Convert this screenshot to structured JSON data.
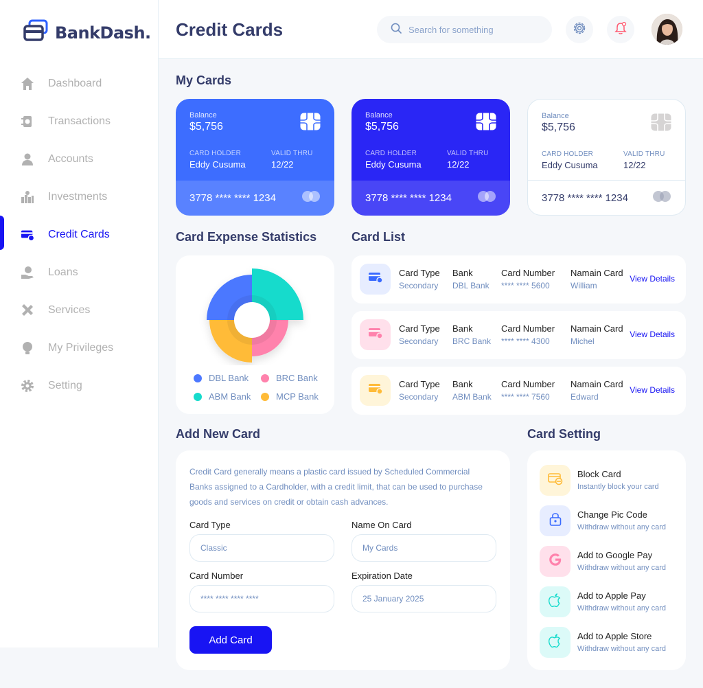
{
  "app": {
    "name": "BankDash."
  },
  "header": {
    "title": "Credit Cards",
    "search_placeholder": "Search for something"
  },
  "sidebar": {
    "items": [
      {
        "label": "Dashboard",
        "icon": "home-icon",
        "active": false
      },
      {
        "label": "Transactions",
        "icon": "transfer-icon",
        "active": false
      },
      {
        "label": "Accounts",
        "icon": "user-icon",
        "active": false
      },
      {
        "label": "Investments",
        "icon": "investment-icon",
        "active": false
      },
      {
        "label": "Credit Cards",
        "icon": "credit-card-icon",
        "active": true
      },
      {
        "label": "Loans",
        "icon": "loan-icon",
        "active": false
      },
      {
        "label": "Services",
        "icon": "services-icon",
        "active": false
      },
      {
        "label": "My Privileges",
        "icon": "lightbulb-icon",
        "active": false
      },
      {
        "label": "Setting",
        "icon": "gear-icon",
        "active": false
      }
    ]
  },
  "sections": {
    "my_cards": "My Cards",
    "expense_stats": "Card Expense Statistics",
    "card_list": "Card List",
    "add_new_card": "Add New Card",
    "card_setting": "Card Setting"
  },
  "cards": [
    {
      "balance_label": "Balance",
      "balance": "$5,756",
      "holder_label": "CARD HOLDER",
      "holder": "Eddy Cusuma",
      "valid_label": "VALID THRU",
      "valid": "12/22",
      "number": "3778 **** **** 1234"
    },
    {
      "balance_label": "Balance",
      "balance": "$5,756",
      "holder_label": "CARD HOLDER",
      "holder": "Eddy Cusuma",
      "valid_label": "VALID THRU",
      "valid": "12/22",
      "number": "3778 **** **** 1234"
    },
    {
      "balance_label": "Balance",
      "balance": "$5,756",
      "holder_label": "CARD HOLDER",
      "holder": "Eddy Cusuma",
      "valid_label": "VALID THRU",
      "valid": "12/22",
      "number": "3778 **** **** 1234"
    }
  ],
  "expense_chart": {
    "legend": [
      {
        "label": "DBL Bank",
        "color": "#4c78ff"
      },
      {
        "label": "BRC Bank",
        "color": "#ff82ac"
      },
      {
        "label": "ABM Bank",
        "color": "#16dbcc"
      },
      {
        "label": "MCP Bank",
        "color": "#ffbb38"
      }
    ]
  },
  "card_list": {
    "col_type": "Card Type",
    "col_bank": "Bank",
    "col_number": "Card Number",
    "col_name": "Namain Card",
    "view_label": "View Details",
    "rows": [
      {
        "type": "Secondary",
        "bank": "DBL Bank",
        "number": "**** **** 5600",
        "name": "William",
        "color": "#e7edff",
        "icon_color": "#396aff"
      },
      {
        "type": "Secondary",
        "bank": "BRC Bank",
        "number": "**** **** 4300",
        "name": "Michel",
        "color": "#ffe0eb",
        "icon_color": "#ff82ac"
      },
      {
        "type": "Secondary",
        "bank": "ABM Bank",
        "number": "**** **** 7560",
        "name": "Edward",
        "color": "#fff5d9",
        "icon_color": "#ffbb38"
      }
    ]
  },
  "add_card": {
    "description": "Credit Card generally means a plastic card issued by Scheduled Commercial Banks assigned to a Cardholder, with a credit limit, that can be used to purchase goods and services on credit or obtain cash advances.",
    "card_type_label": "Card Type",
    "card_type_placeholder": "Classic",
    "name_label": "Name On Card",
    "name_placeholder": "My Cards",
    "number_label": "Card Number",
    "number_placeholder": "**** **** **** ****",
    "expiry_label": "Expiration Date",
    "expiry_placeholder": "25 January 2025",
    "button": "Add Card"
  },
  "card_setting": [
    {
      "title": "Block Card",
      "subtitle": "Instantly block your card",
      "bg": "#fff5d9"
    },
    {
      "title": "Change Pic Code",
      "subtitle": "Withdraw without any card",
      "bg": "#e7edff"
    },
    {
      "title": "Add to Google Pay",
      "subtitle": "Withdraw without any card",
      "bg": "#ffe0eb"
    },
    {
      "title": "Add to Apple Pay",
      "subtitle": "Withdraw without any card",
      "bg": "#dcfaf8"
    },
    {
      "title": "Add to Apple Store",
      "subtitle": "Withdraw without any card",
      "bg": "#dcfaf8"
    }
  ]
}
